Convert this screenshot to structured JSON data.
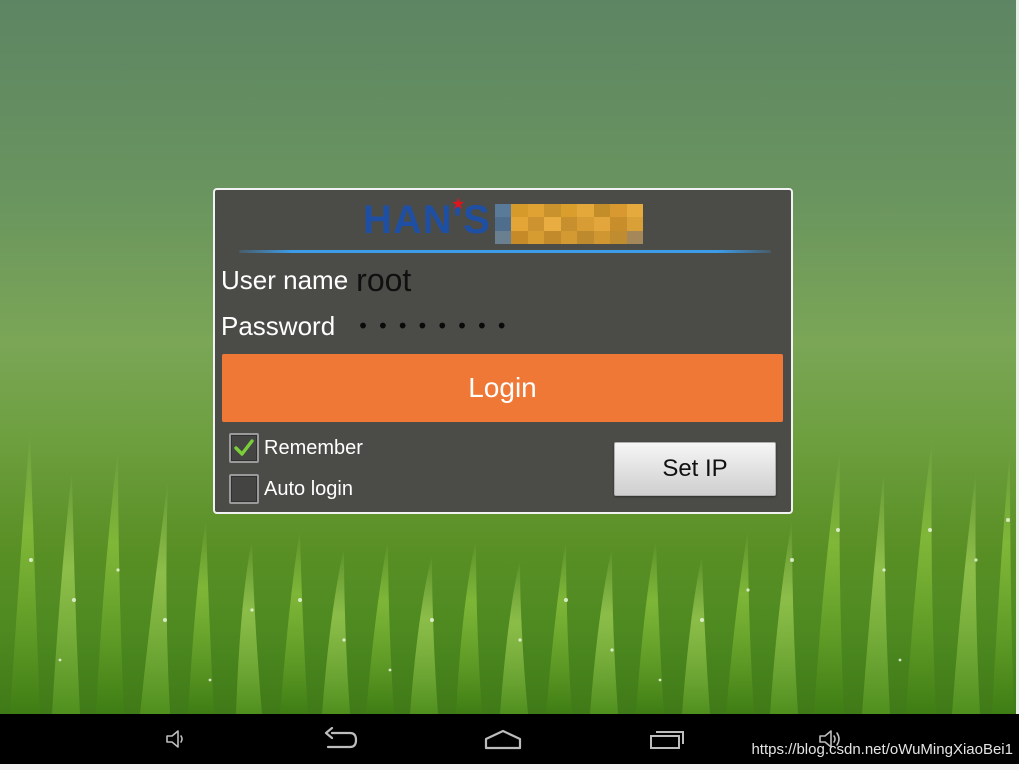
{
  "logo": {
    "text": "HAN'S"
  },
  "form": {
    "username_label": "User name",
    "username_value": "root",
    "password_label": "Password",
    "password_mask": "••••••••"
  },
  "buttons": {
    "login": "Login",
    "set_ip": "Set IP"
  },
  "options": {
    "remember_label": "Remember",
    "remember_checked": true,
    "auto_login_label": "Auto login",
    "auto_login_checked": false
  },
  "navbar": {
    "icons": [
      "volume-down-icon",
      "back-icon",
      "home-icon",
      "recent-apps-icon",
      "volume-up-icon"
    ]
  },
  "watermark": "https://blog.csdn.net/oWuMingXiaoBei1",
  "colors": {
    "login_button": "#f07836",
    "dialog_background": "#4b4c48",
    "logo_blue": "#1f4fa3",
    "check_green": "#7ccd3a"
  }
}
